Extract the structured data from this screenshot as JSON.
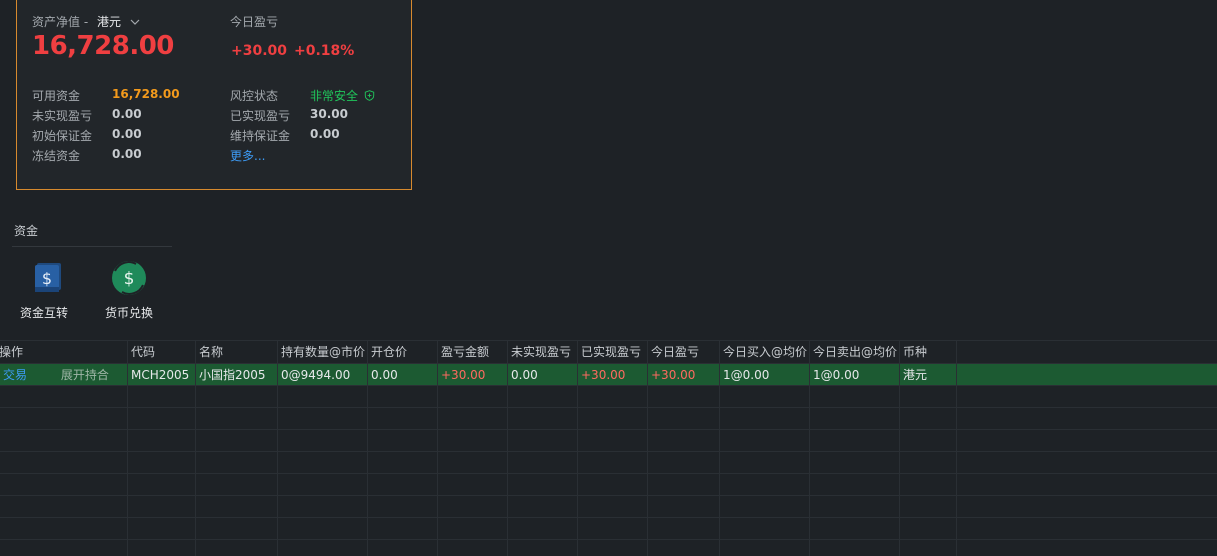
{
  "account": {
    "net_label": "资产净值 -",
    "currency": "港元",
    "chevron_icon": "chevron-down-icon",
    "net_value": "16,728.00",
    "today_pl_label": "今日盈亏",
    "today_pl": "+30.00",
    "today_pl_pct": "+0.18%",
    "rows": {
      "available_funds_label": "可用资金",
      "available_funds": "16,728.00",
      "unrealized_label": "未实现盈亏",
      "unrealized": "0.00",
      "initial_margin_label": "初始保证金",
      "initial_margin": "0.00",
      "frozen_label": "冻结资金",
      "frozen": "0.00",
      "risk_label": "风控状态",
      "risk_status": "非常安全",
      "realized_label": "已实现盈亏",
      "realized": "30.00",
      "maint_margin_label": "维持保证金",
      "maint_margin": "0.00",
      "more": "更多..."
    }
  },
  "funds": {
    "title": "资金",
    "transfer_label": "资金互转",
    "exchange_label": "货币兑换"
  },
  "table": {
    "headers": [
      "操作",
      "代码",
      "名称",
      "持有数量@市价",
      "开仓价",
      "盈亏金额",
      "未实现盈亏",
      "已实现盈亏",
      "今日盈亏",
      "今日买入@均价",
      "今日卖出@均价",
      "币种"
    ],
    "rows": [
      {
        "trade": "交易",
        "expand": "展开持合",
        "code": "MCH2005",
        "name": "小国指2005",
        "qty_price": "0@9494.00",
        "open_price": "0.00",
        "pl": "+30.00",
        "unrealized": "0.00",
        "realized": "+30.00",
        "today_pl": "+30.00",
        "buy_today": "1@0.00",
        "sell_today": "1@0.00",
        "currency": "港元"
      }
    ]
  },
  "colors": {
    "accent_border": "#d78a2e",
    "loss_gain_red": "#ef3f41",
    "available_orange": "#f39a1c",
    "safe_green": "#20c55b",
    "link_blue": "#3d9bf5",
    "selected_row": "#1c5a32"
  }
}
